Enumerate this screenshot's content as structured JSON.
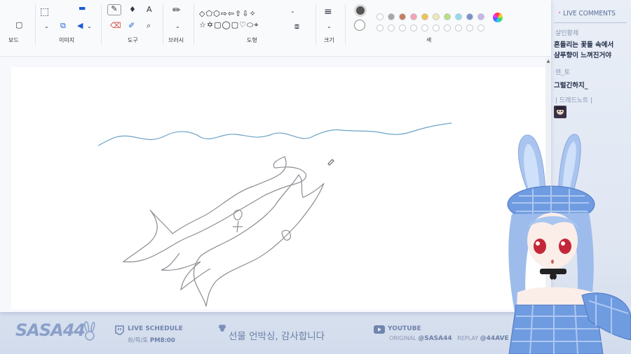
{
  "ribbon": {
    "groups": [
      "보드",
      "이미지",
      "도구",
      "브러시",
      "도형",
      "크기",
      "색"
    ],
    "shapes": "◇⬠⬡⇨⇦⇧⇩✧\n☆✡▢◯▢♡⬭⌖"
  },
  "colors": {
    "palette_row1": [
      "#ffffff",
      "#a7a7a7",
      "#c67b5c",
      "#f6a1b4",
      "#f3c24c",
      "#efe9b2",
      "#b9e07a",
      "#8fdcf0",
      "#7891c9",
      "#c7b6e9"
    ],
    "accent": "#1c5bd6"
  },
  "comments": {
    "title": "LIVE COMMENTS",
    "items": [
      {
        "name": "살인황제",
        "lines": [
          "흔들리는 꽃들 속에서",
          "샴푸향이 느껴진거야"
        ]
      },
      {
        "name": "렌_토",
        "lines": [
          "그럴긴하지_"
        ]
      },
      {
        "name": "| 드레드노트 |",
        "lines": []
      }
    ]
  },
  "bottom": {
    "logo": "SASA44",
    "schedule_title": "LIVE SCHEDULE",
    "schedule_days": "화/목/토",
    "schedule_time": "PM8:00",
    "notice": "선물 언박싱, 감사합니다",
    "youtube_title": "YOUTUBE",
    "original_label": "ORIGINAL",
    "original_handle": "@SASA44",
    "replay_label": "REPLAY",
    "replay_handle": "@44AVE"
  }
}
